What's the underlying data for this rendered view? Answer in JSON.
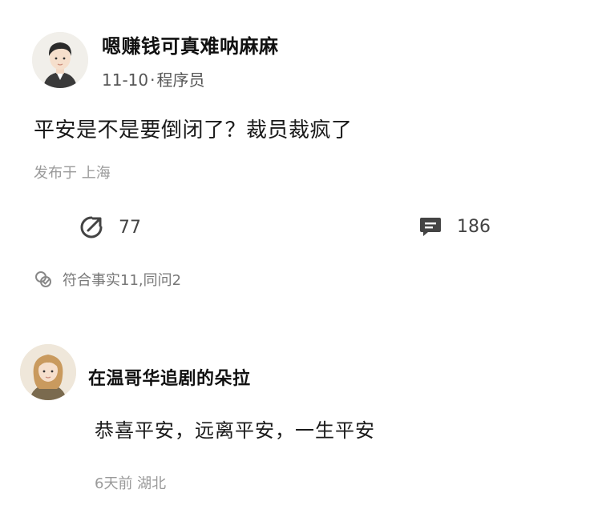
{
  "post": {
    "author": "嗯赚钱可真难呐麻麻",
    "date": "11-10",
    "separator": "·",
    "occupation": "程序员",
    "content": "平安是不是要倒闭了？裁员裁疯了",
    "location": "发布于 上海",
    "shares": "77",
    "comments": "186",
    "facts": "符合事实11,同问2"
  },
  "comment": {
    "author": "在温哥华追剧的朵拉",
    "text": "恭喜平安，远离平安，一生平安",
    "meta": "6天前 湖北"
  }
}
